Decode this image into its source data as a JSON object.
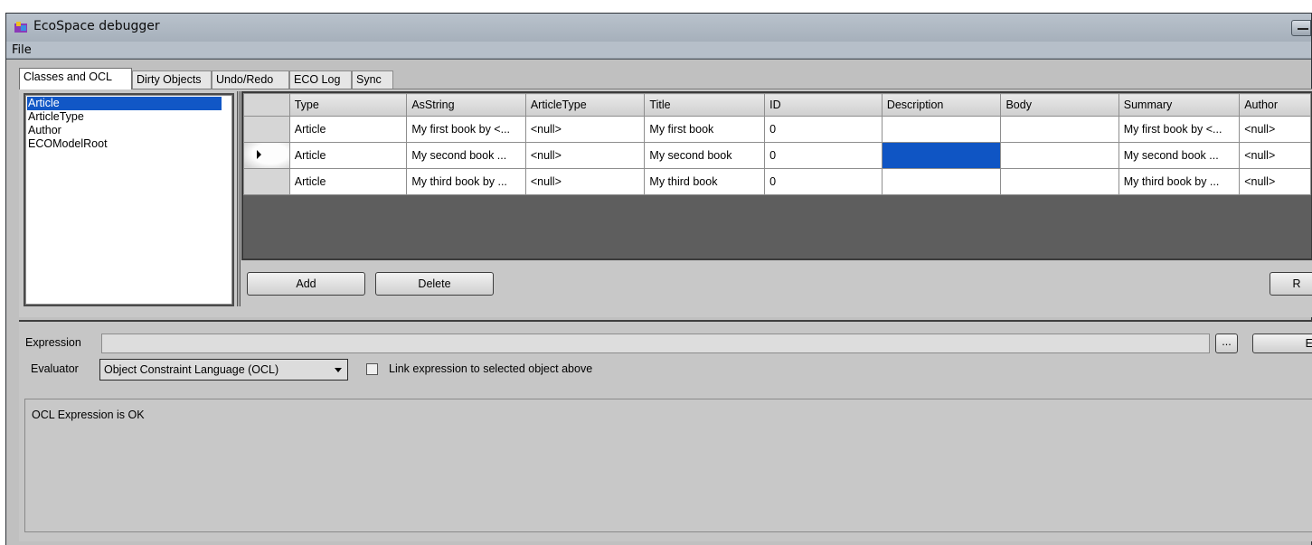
{
  "window": {
    "title": "EcoSpace debugger"
  },
  "menu": {
    "file": "File"
  },
  "tabs": [
    "Classes and OCL",
    "Dirty Objects",
    "Undo/Redo",
    "ECO Log",
    "Sync"
  ],
  "classes": {
    "items": [
      "Article",
      "ArticleType",
      "Author",
      "ECOModelRoot"
    ],
    "selected": "Article"
  },
  "grid": {
    "columns": [
      "Type",
      "AsString",
      "ArticleType",
      "Title",
      "ID",
      "Description",
      "Body",
      "Summary",
      "Author"
    ],
    "rows": [
      [
        "Article",
        "My first book by <...",
        "<null>",
        "My first book",
        "0",
        "",
        "",
        "My first book by <...",
        "<null>"
      ],
      [
        "Article",
        "My second book ...",
        "<null>",
        "My second book",
        "0",
        "",
        "",
        "My second book ...",
        "<null>"
      ],
      [
        "Article",
        "My third book by ...",
        "<null>",
        "My third book",
        "0",
        "",
        "",
        "My third book by ...",
        "<null>"
      ]
    ]
  },
  "buttons": {
    "add": "Add",
    "delete": "Delete",
    "refresh": "R",
    "browse": "...",
    "evaluate": "E"
  },
  "expression": {
    "label": "Expression",
    "value": ""
  },
  "evaluator": {
    "label": "Evaluator",
    "selected": "Object Constraint Language (OCL)"
  },
  "link_checkbox": {
    "label": "Link expression to selected object above",
    "checked": false
  },
  "output": {
    "text": "OCL Expression is OK"
  },
  "colors": {
    "selection": "#1157c6",
    "grid_background": "#5e5e5e",
    "form_background": "#c0c0c0"
  }
}
